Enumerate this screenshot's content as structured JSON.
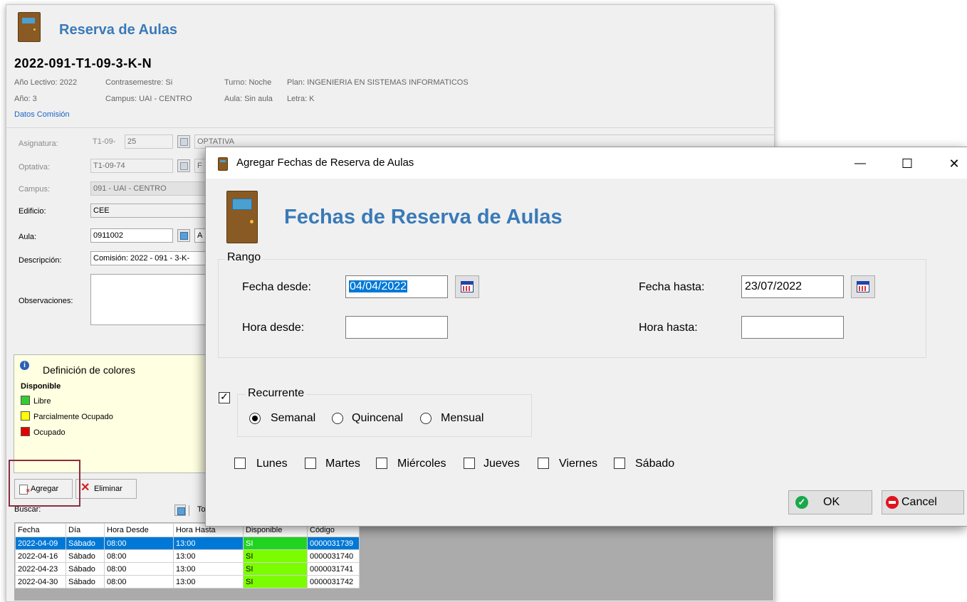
{
  "background_window": {
    "header_title": "Reserva de Aulas",
    "commission_code": "2022-091-T1-09-3-K-N",
    "info": {
      "anio_lectivo": "Año Lectivo: 2022",
      "contrasemestre": "Contrasemestre: Si",
      "turno": "Turno: Noche",
      "plan": "Plan: INGENIERIA EN SISTEMAS INFORMATICOS",
      "anio": "Año: 3",
      "campus": "Campus: UAI - CENTRO",
      "aula": "Aula: Sin aula",
      "letra": "Letra: K"
    },
    "datos_comision_link": "Datos Comisión",
    "form": {
      "asignatura_label": "Asignatura:",
      "asignatura_prefix": "T1-09-",
      "asignatura_code": "25",
      "asignatura_name": "OPTATIVA",
      "optativa_label": "Optativa:",
      "optativa_code": "T1-09-74",
      "optativa_name": "F",
      "campus_label": "Campus:",
      "campus_value": "091 - UAI - CENTRO",
      "edificio_label": "Edificio:",
      "edificio_value": "CEE",
      "aula_label": "Aula:",
      "aula_value": "0911002",
      "aula_extra": "A",
      "descripcion_label": "Descripción:",
      "descripcion_value": "Comisión: 2022 - 091 - 3-K-",
      "observaciones_label": "Observaciones:"
    },
    "legend": {
      "title": "Definición de colores",
      "subtitle": "Disponible",
      "items": [
        {
          "label": "Libre",
          "color": "#33cc33"
        },
        {
          "label": "Parcialmente Ocupado",
          "color": "#ffff00"
        },
        {
          "label": "Ocupado",
          "color": "#e00000"
        }
      ]
    },
    "buttons": {
      "agregar": "Agregar",
      "eliminar": "Eliminar"
    },
    "buscar_label": "Buscar:",
    "search_tail": "To",
    "grid": {
      "headers": [
        "Fecha",
        "Día",
        "Hora Desde",
        "Hora Hasta",
        "Disponible",
        "Código"
      ],
      "rows": [
        [
          "2022-04-09",
          "Sábado",
          "08:00",
          "13:00",
          "SI",
          "0000031739"
        ],
        [
          "2022-04-16",
          "Sábado",
          "08:00",
          "13:00",
          "SI",
          "0000031740"
        ],
        [
          "2022-04-23",
          "Sábado",
          "08:00",
          "13:00",
          "SI",
          "0000031741"
        ],
        [
          "2022-04-30",
          "Sábado",
          "08:00",
          "13:00",
          "SI",
          "0000031742"
        ]
      ]
    }
  },
  "dialog": {
    "window_title": "Agregar Fechas de Reserva de Aulas",
    "controls": {
      "minimize": "—",
      "maximize": "☐",
      "close": "✕"
    },
    "header_title": "Fechas de Reserva de Aulas",
    "rango": {
      "label": "Rango",
      "fecha_desde_label": "Fecha desde:",
      "fecha_desde_value": "04/04/2022",
      "fecha_hasta_label": "Fecha hasta:",
      "fecha_hasta_value": "23/07/2022",
      "hora_desde_label": "Hora desde:",
      "hora_desde_value": "",
      "hora_hasta_label": "Hora hasta:",
      "hora_hasta_value": ""
    },
    "recurrente": {
      "label": "Recurrente",
      "checked": true,
      "options": [
        "Semanal",
        "Quincenal",
        "Mensual"
      ],
      "selected": "Semanal"
    },
    "days": [
      "Lunes",
      "Martes",
      "Miércoles",
      "Jueves",
      "Viernes",
      "Sábado"
    ],
    "buttons": {
      "ok": "OK",
      "cancel": "Cancel"
    }
  },
  "colors": {
    "accent_title": "#3a7ab8",
    "selection": "#0078d7",
    "available_green": "#7cfc00",
    "highlight_box": "#8b2d3e"
  }
}
